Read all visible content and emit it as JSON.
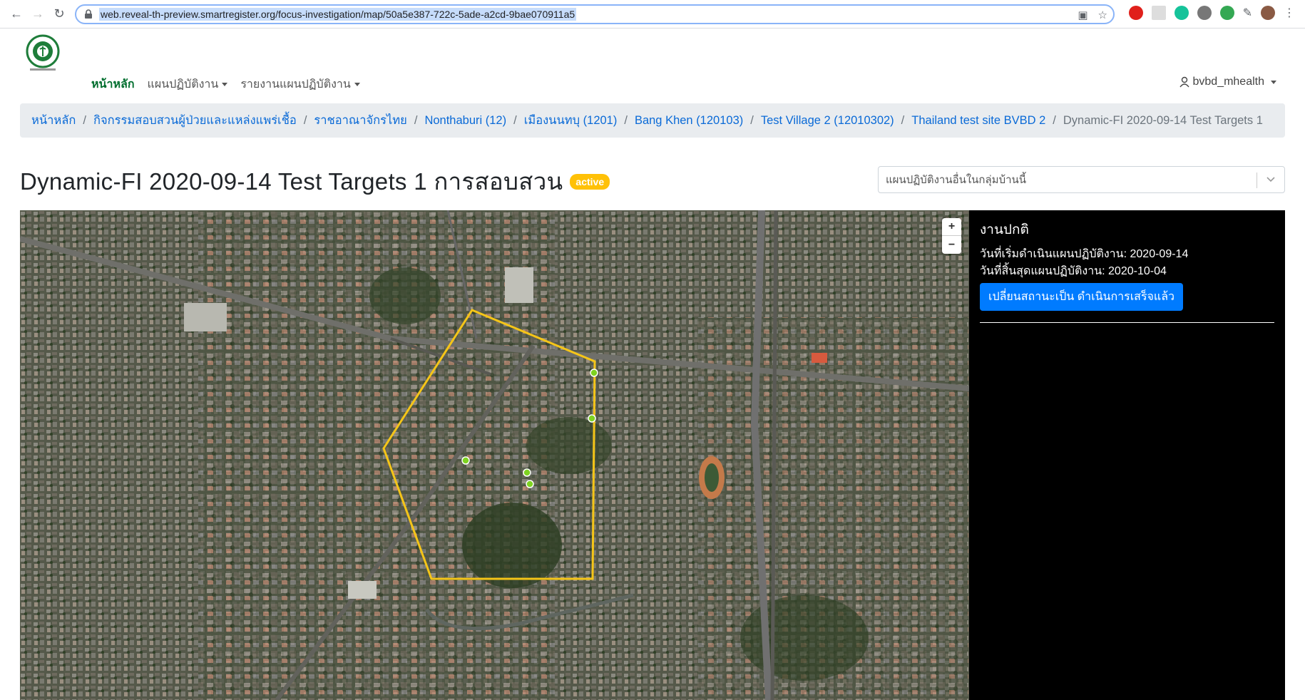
{
  "browser": {
    "url": "web.reveal-th-preview.smartregister.org/focus-investigation/map/50a5e387-722c-5ade-a2cd-9bae070911a5"
  },
  "nav": {
    "home": "หน้าหลัก",
    "plans": "แผนปฏิบัติงาน",
    "reports": "รายงานแผนปฏิบัติงาน",
    "user": "bvbd_mhealth"
  },
  "breadcrumb": {
    "items": [
      "หน้าหลัก",
      "กิจกรรมสอบสวนผู้ป่วยและแหล่งแพร่เชื้อ",
      "ราชอาณาจักรไทย",
      "Nonthaburi (12)",
      "เมืองนนทบุ (1201)",
      "Bang Khen (120103)",
      "Test Village 2 (12010302)",
      "Thailand test site BVBD 2"
    ],
    "active": "Dynamic-FI 2020-09-14 Test Targets 1"
  },
  "page": {
    "title": "Dynamic-FI 2020-09-14 Test Targets 1 การสอบสวน",
    "status": "active",
    "select_placeholder": "แผนปฏิบัติงานอื่นในกลุ่มบ้านนี้"
  },
  "map": {
    "zoom_in": "+",
    "zoom_out": "−",
    "boundary_color": "#f5c518",
    "point_color": "#7ed321"
  },
  "panel": {
    "title": "งานปกติ",
    "start_label": "วันที่เริ่มดำเนินแผนปฏิบัติงาน:",
    "start_value": "2020-09-14",
    "end_label": "วันที่สิ้นสุดแผนปฏิบัติงาน:",
    "end_value": "2020-10-04",
    "button": "เปลี่ยนสถานะเป็น ดำเนินการเสร็จแล้ว"
  }
}
